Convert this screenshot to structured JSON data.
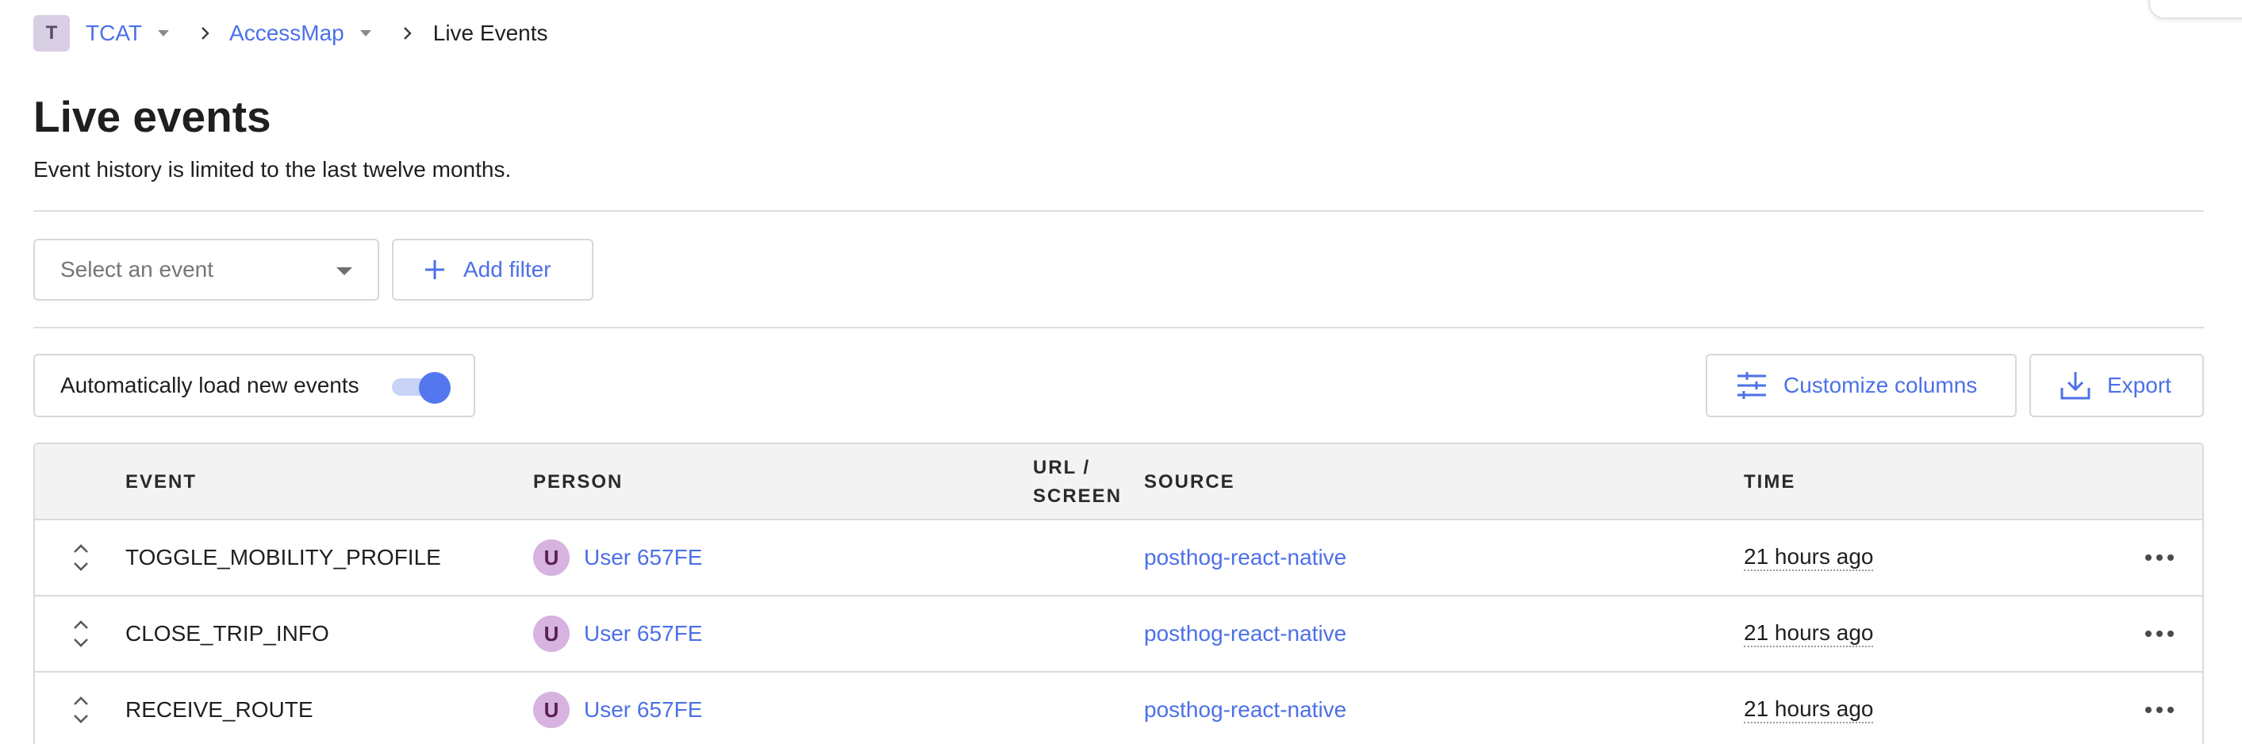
{
  "breadcrumb": {
    "org_initial": "T",
    "org": "TCAT",
    "project": "AccessMap",
    "current": "Live Events"
  },
  "page": {
    "title": "Live events",
    "subtitle": "Event history is limited to the last twelve months."
  },
  "filters": {
    "event_placeholder": "Select an event",
    "add_filter_label": "Add filter"
  },
  "toolbar": {
    "autoload_label": "Automatically load new events",
    "autoload_on": true,
    "customize_label": "Customize columns",
    "export_label": "Export"
  },
  "table": {
    "columns": {
      "event": "EVENT",
      "person": "PERSON",
      "url_line1": "URL /",
      "url_line2": "SCREEN",
      "source": "SOURCE",
      "time": "TIME"
    },
    "rows": [
      {
        "event": "TOGGLE_MOBILITY_PROFILE",
        "person_initial": "U",
        "person": "User 657FE",
        "url": "",
        "source": "posthog-react-native",
        "time": "21 hours ago"
      },
      {
        "event": "CLOSE_TRIP_INFO",
        "person_initial": "U",
        "person": "User 657FE",
        "url": "",
        "source": "posthog-react-native",
        "time": "21 hours ago"
      },
      {
        "event": "RECEIVE_ROUTE",
        "person_initial": "U",
        "person": "User 657FE",
        "url": "",
        "source": "posthog-react-native",
        "time": "21 hours ago"
      }
    ]
  },
  "colors": {
    "accent": "#4c70e8",
    "toggle": "#5477ef",
    "header_bg": "#f3f3f3",
    "avatar_bg": "#d6b3e0"
  },
  "icons": [
    "chevron-down-icon",
    "chevron-right-icon",
    "plus-icon",
    "sliders-icon",
    "download-icon",
    "expand-icon",
    "more-icon"
  ]
}
